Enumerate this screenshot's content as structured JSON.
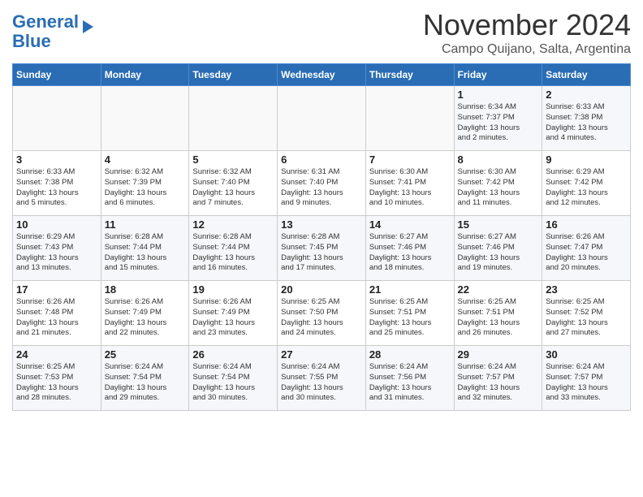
{
  "logo": {
    "line1": "General",
    "line2": "Blue"
  },
  "title": "November 2024",
  "location": "Campo Quijano, Salta, Argentina",
  "weekdays": [
    "Sunday",
    "Monday",
    "Tuesday",
    "Wednesday",
    "Thursday",
    "Friday",
    "Saturday"
  ],
  "weeks": [
    [
      {
        "day": "",
        "info": ""
      },
      {
        "day": "",
        "info": ""
      },
      {
        "day": "",
        "info": ""
      },
      {
        "day": "",
        "info": ""
      },
      {
        "day": "",
        "info": ""
      },
      {
        "day": "1",
        "info": "Sunrise: 6:34 AM\nSunset: 7:37 PM\nDaylight: 13 hours\nand 2 minutes."
      },
      {
        "day": "2",
        "info": "Sunrise: 6:33 AM\nSunset: 7:38 PM\nDaylight: 13 hours\nand 4 minutes."
      }
    ],
    [
      {
        "day": "3",
        "info": "Sunrise: 6:33 AM\nSunset: 7:38 PM\nDaylight: 13 hours\nand 5 minutes."
      },
      {
        "day": "4",
        "info": "Sunrise: 6:32 AM\nSunset: 7:39 PM\nDaylight: 13 hours\nand 6 minutes."
      },
      {
        "day": "5",
        "info": "Sunrise: 6:32 AM\nSunset: 7:40 PM\nDaylight: 13 hours\nand 7 minutes."
      },
      {
        "day": "6",
        "info": "Sunrise: 6:31 AM\nSunset: 7:40 PM\nDaylight: 13 hours\nand 9 minutes."
      },
      {
        "day": "7",
        "info": "Sunrise: 6:30 AM\nSunset: 7:41 PM\nDaylight: 13 hours\nand 10 minutes."
      },
      {
        "day": "8",
        "info": "Sunrise: 6:30 AM\nSunset: 7:42 PM\nDaylight: 13 hours\nand 11 minutes."
      },
      {
        "day": "9",
        "info": "Sunrise: 6:29 AM\nSunset: 7:42 PM\nDaylight: 13 hours\nand 12 minutes."
      }
    ],
    [
      {
        "day": "10",
        "info": "Sunrise: 6:29 AM\nSunset: 7:43 PM\nDaylight: 13 hours\nand 13 minutes."
      },
      {
        "day": "11",
        "info": "Sunrise: 6:28 AM\nSunset: 7:44 PM\nDaylight: 13 hours\nand 15 minutes."
      },
      {
        "day": "12",
        "info": "Sunrise: 6:28 AM\nSunset: 7:44 PM\nDaylight: 13 hours\nand 16 minutes."
      },
      {
        "day": "13",
        "info": "Sunrise: 6:28 AM\nSunset: 7:45 PM\nDaylight: 13 hours\nand 17 minutes."
      },
      {
        "day": "14",
        "info": "Sunrise: 6:27 AM\nSunset: 7:46 PM\nDaylight: 13 hours\nand 18 minutes."
      },
      {
        "day": "15",
        "info": "Sunrise: 6:27 AM\nSunset: 7:46 PM\nDaylight: 13 hours\nand 19 minutes."
      },
      {
        "day": "16",
        "info": "Sunrise: 6:26 AM\nSunset: 7:47 PM\nDaylight: 13 hours\nand 20 minutes."
      }
    ],
    [
      {
        "day": "17",
        "info": "Sunrise: 6:26 AM\nSunset: 7:48 PM\nDaylight: 13 hours\nand 21 minutes."
      },
      {
        "day": "18",
        "info": "Sunrise: 6:26 AM\nSunset: 7:49 PM\nDaylight: 13 hours\nand 22 minutes."
      },
      {
        "day": "19",
        "info": "Sunrise: 6:26 AM\nSunset: 7:49 PM\nDaylight: 13 hours\nand 23 minutes."
      },
      {
        "day": "20",
        "info": "Sunrise: 6:25 AM\nSunset: 7:50 PM\nDaylight: 13 hours\nand 24 minutes."
      },
      {
        "day": "21",
        "info": "Sunrise: 6:25 AM\nSunset: 7:51 PM\nDaylight: 13 hours\nand 25 minutes."
      },
      {
        "day": "22",
        "info": "Sunrise: 6:25 AM\nSunset: 7:51 PM\nDaylight: 13 hours\nand 26 minutes."
      },
      {
        "day": "23",
        "info": "Sunrise: 6:25 AM\nSunset: 7:52 PM\nDaylight: 13 hours\nand 27 minutes."
      }
    ],
    [
      {
        "day": "24",
        "info": "Sunrise: 6:25 AM\nSunset: 7:53 PM\nDaylight: 13 hours\nand 28 minutes."
      },
      {
        "day": "25",
        "info": "Sunrise: 6:24 AM\nSunset: 7:54 PM\nDaylight: 13 hours\nand 29 minutes."
      },
      {
        "day": "26",
        "info": "Sunrise: 6:24 AM\nSunset: 7:54 PM\nDaylight: 13 hours\nand 30 minutes."
      },
      {
        "day": "27",
        "info": "Sunrise: 6:24 AM\nSunset: 7:55 PM\nDaylight: 13 hours\nand 30 minutes."
      },
      {
        "day": "28",
        "info": "Sunrise: 6:24 AM\nSunset: 7:56 PM\nDaylight: 13 hours\nand 31 minutes."
      },
      {
        "day": "29",
        "info": "Sunrise: 6:24 AM\nSunset: 7:57 PM\nDaylight: 13 hours\nand 32 minutes."
      },
      {
        "day": "30",
        "info": "Sunrise: 6:24 AM\nSunset: 7:57 PM\nDaylight: 13 hours\nand 33 minutes."
      }
    ]
  ]
}
